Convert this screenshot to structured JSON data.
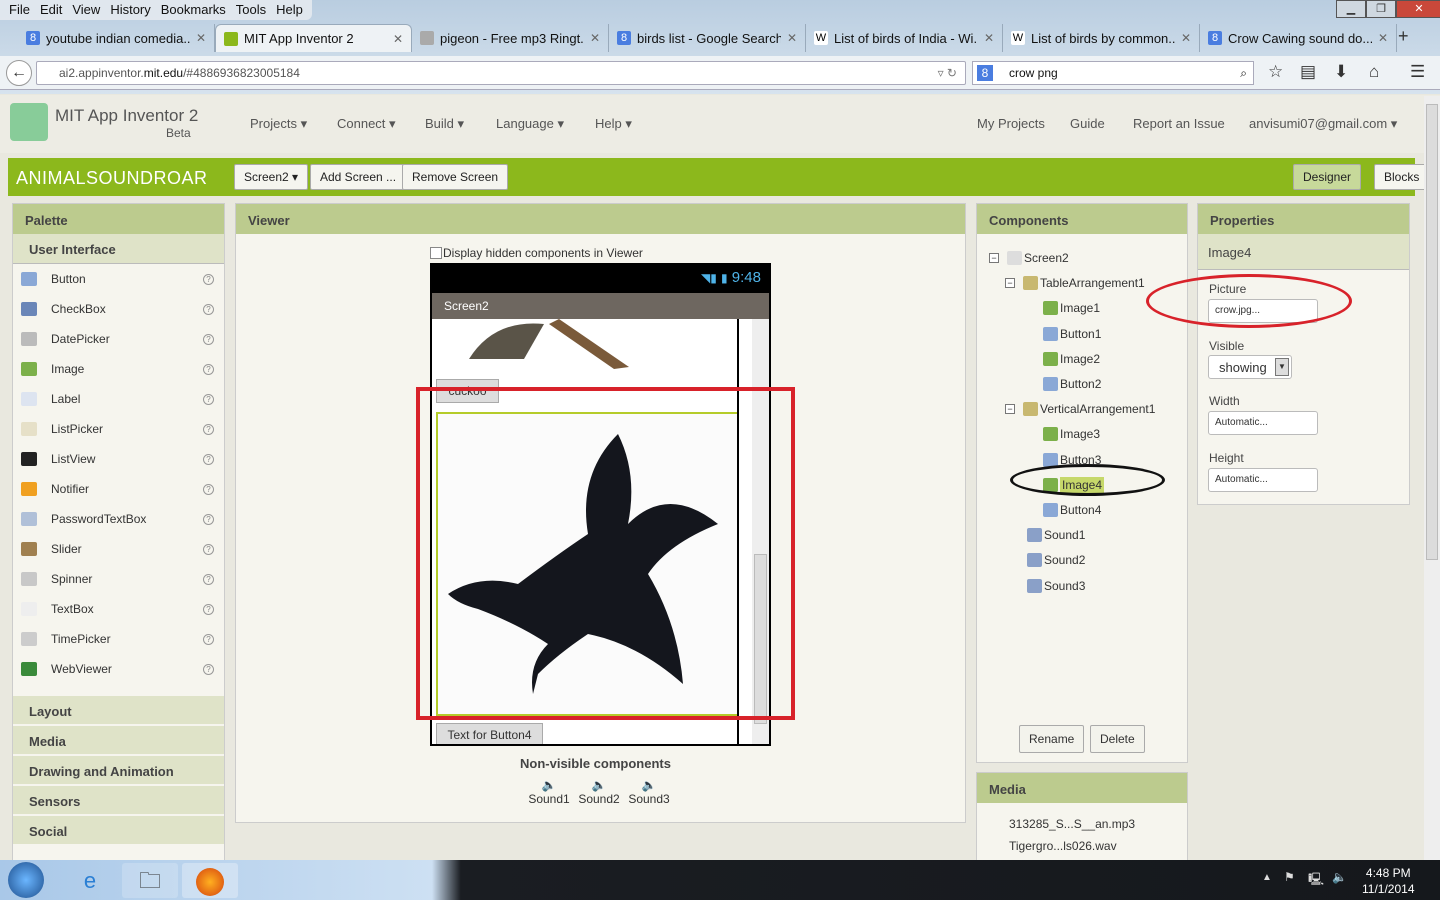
{
  "browser": {
    "menu": [
      "File",
      "Edit",
      "View",
      "History",
      "Bookmarks",
      "Tools",
      "Help"
    ],
    "tabs": [
      {
        "title": "youtube indian comedia...",
        "icon": "google-icon",
        "active": false
      },
      {
        "title": "MIT App Inventor 2",
        "icon": "app-inventor-icon",
        "active": true
      },
      {
        "title": "pigeon - Free mp3 Ringt...",
        "icon": "ringtone-icon",
        "active": false
      },
      {
        "title": "birds list - Google Search",
        "icon": "google-icon",
        "active": false
      },
      {
        "title": "List of birds of India - Wi...",
        "icon": "wikipedia-icon",
        "active": false
      },
      {
        "title": "List of birds by common...",
        "icon": "wikipedia-icon",
        "active": false
      },
      {
        "title": "Crow Cawing sound do...",
        "icon": "google-icon",
        "active": false
      }
    ],
    "url_prefix": "ai2.appinventor.",
    "url_domain": "mit.edu",
    "url_suffix": "/#4886936823005184",
    "search_value": "crow png"
  },
  "app": {
    "title": "MIT App Inventor 2",
    "beta": "Beta",
    "menus": [
      "Projects ▾",
      "Connect ▾",
      "Build ▾",
      "Language ▾",
      "Help ▾"
    ],
    "right_links": [
      "My Projects",
      "Guide",
      "Report an Issue",
      "anvisumi07@gmail.com ▾"
    ],
    "project_name": "ANIMALSOUNDROAR",
    "screen_select": "Screen2 ▾",
    "add_screen": "Add Screen ...",
    "remove_screen": "Remove Screen",
    "designer": "Designer",
    "blocks": "Blocks",
    "accent": "#8cb81c"
  },
  "palette": {
    "title": "Palette",
    "section": "User Interface",
    "items": [
      "Button",
      "CheckBox",
      "DatePicker",
      "Image",
      "Label",
      "ListPicker",
      "ListView",
      "Notifier",
      "PasswordTextBox",
      "Slider",
      "Spinner",
      "TextBox",
      "TimePicker",
      "WebViewer"
    ],
    "help": "?",
    "categories": [
      "Layout",
      "Media",
      "Drawing and Animation",
      "Sensors",
      "Social"
    ]
  },
  "viewer": {
    "title": "Viewer",
    "hidden_checkbox": "Display hidden components in Viewer",
    "time": "9:48",
    "screen_title": "Screen2",
    "button_cuckoo": "cuckoo",
    "button4": "Text for Button4",
    "nonvisible_title": "Non-visible components",
    "nonvisible": [
      "Sound1",
      "Sound2",
      "Sound3"
    ]
  },
  "components": {
    "title": "Components",
    "tree": [
      {
        "name": "Screen2",
        "level": 0,
        "toggle": "⊟",
        "type": "screen"
      },
      {
        "name": "TableArrangement1",
        "level": 1,
        "toggle": "⊟",
        "type": "table"
      },
      {
        "name": "Image1",
        "level": 2,
        "type": "image"
      },
      {
        "name": "Button1",
        "level": 2,
        "type": "button"
      },
      {
        "name": "Image2",
        "level": 2,
        "type": "image"
      },
      {
        "name": "Button2",
        "level": 2,
        "type": "button"
      },
      {
        "name": "VerticalArrangement1",
        "level": 1,
        "toggle": "⊟",
        "type": "vertical"
      },
      {
        "name": "Image3",
        "level": 2,
        "type": "image"
      },
      {
        "name": "Button3",
        "level": 2,
        "type": "button"
      },
      {
        "name": "Image4",
        "level": 2,
        "type": "image",
        "selected": true
      },
      {
        "name": "Button4",
        "level": 2,
        "type": "button"
      },
      {
        "name": "Sound1",
        "level": 1,
        "type": "sound"
      },
      {
        "name": "Sound2",
        "level": 1,
        "type": "sound"
      },
      {
        "name": "Sound3",
        "level": 1,
        "type": "sound"
      }
    ],
    "rename": "Rename",
    "delete": "Delete"
  },
  "media": {
    "title": "Media",
    "files": [
      "313285_S...S__an.mp3",
      "Tigergro...ls026.wav"
    ]
  },
  "properties": {
    "title": "Properties",
    "component": "Image4",
    "picture_label": "Picture",
    "picture_value": "crow.jpg...",
    "visible_label": "Visible",
    "visible_value": "showing",
    "width_label": "Width",
    "width_value": "Automatic...",
    "height_label": "Height",
    "height_value": "Automatic..."
  },
  "taskbar": {
    "time": "4:48 PM",
    "date": "11/1/2014"
  }
}
